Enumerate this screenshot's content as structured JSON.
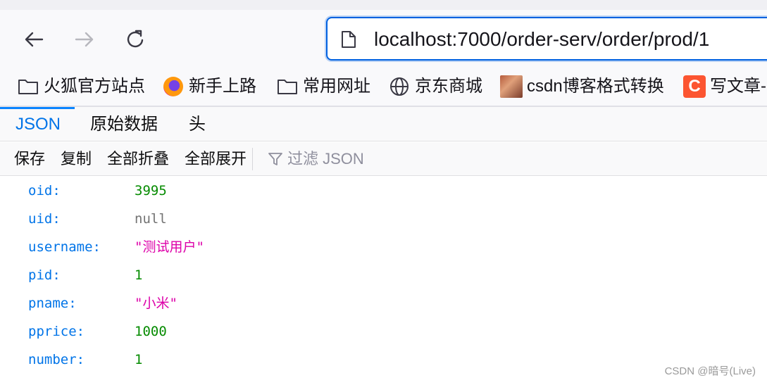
{
  "browser": {
    "url": "localhost:7000/order-serv/order/prod/1"
  },
  "bookmarks": [
    {
      "label": "火狐官方站点",
      "icon": "folder-icon"
    },
    {
      "label": "新手上路",
      "icon": "firefox-icon"
    },
    {
      "label": "常用网址",
      "icon": "folder-icon"
    },
    {
      "label": "京东商城",
      "icon": "globe-icon"
    },
    {
      "label": "csdn博客格式转换",
      "icon": "avatar-icon"
    },
    {
      "label": "写文章-",
      "icon": "csdn-icon",
      "icon_letter": "C"
    }
  ],
  "viewer": {
    "tabs": [
      {
        "label": "JSON",
        "active": true
      },
      {
        "label": "原始数据",
        "active": false
      },
      {
        "label": "头",
        "active": false
      }
    ],
    "toolbar": {
      "save": "保存",
      "copy": "复制",
      "collapse_all": "全部折叠",
      "expand_all": "全部展开",
      "filter_placeholder": "过滤 JSON"
    }
  },
  "json_rows": [
    {
      "key": "oid:",
      "value": "3995",
      "type": "number"
    },
    {
      "key": "uid:",
      "value": "null",
      "type": "null"
    },
    {
      "key": "username:",
      "value": "\"测试用户\"",
      "type": "string"
    },
    {
      "key": "pid:",
      "value": "1",
      "type": "number"
    },
    {
      "key": "pname:",
      "value": "\"小米\"",
      "type": "string"
    },
    {
      "key": "pprice:",
      "value": "1000",
      "type": "number"
    },
    {
      "key": "number:",
      "value": "1",
      "type": "number"
    }
  ],
  "watermark": "CSDN @暗号(Live)",
  "colors": {
    "accent": "#0061e0",
    "json_key": "#0074e8",
    "json_number": "#058b00",
    "json_string": "#dd00a9",
    "json_null": "#737373",
    "csdn_brand": "#fc5531"
  }
}
